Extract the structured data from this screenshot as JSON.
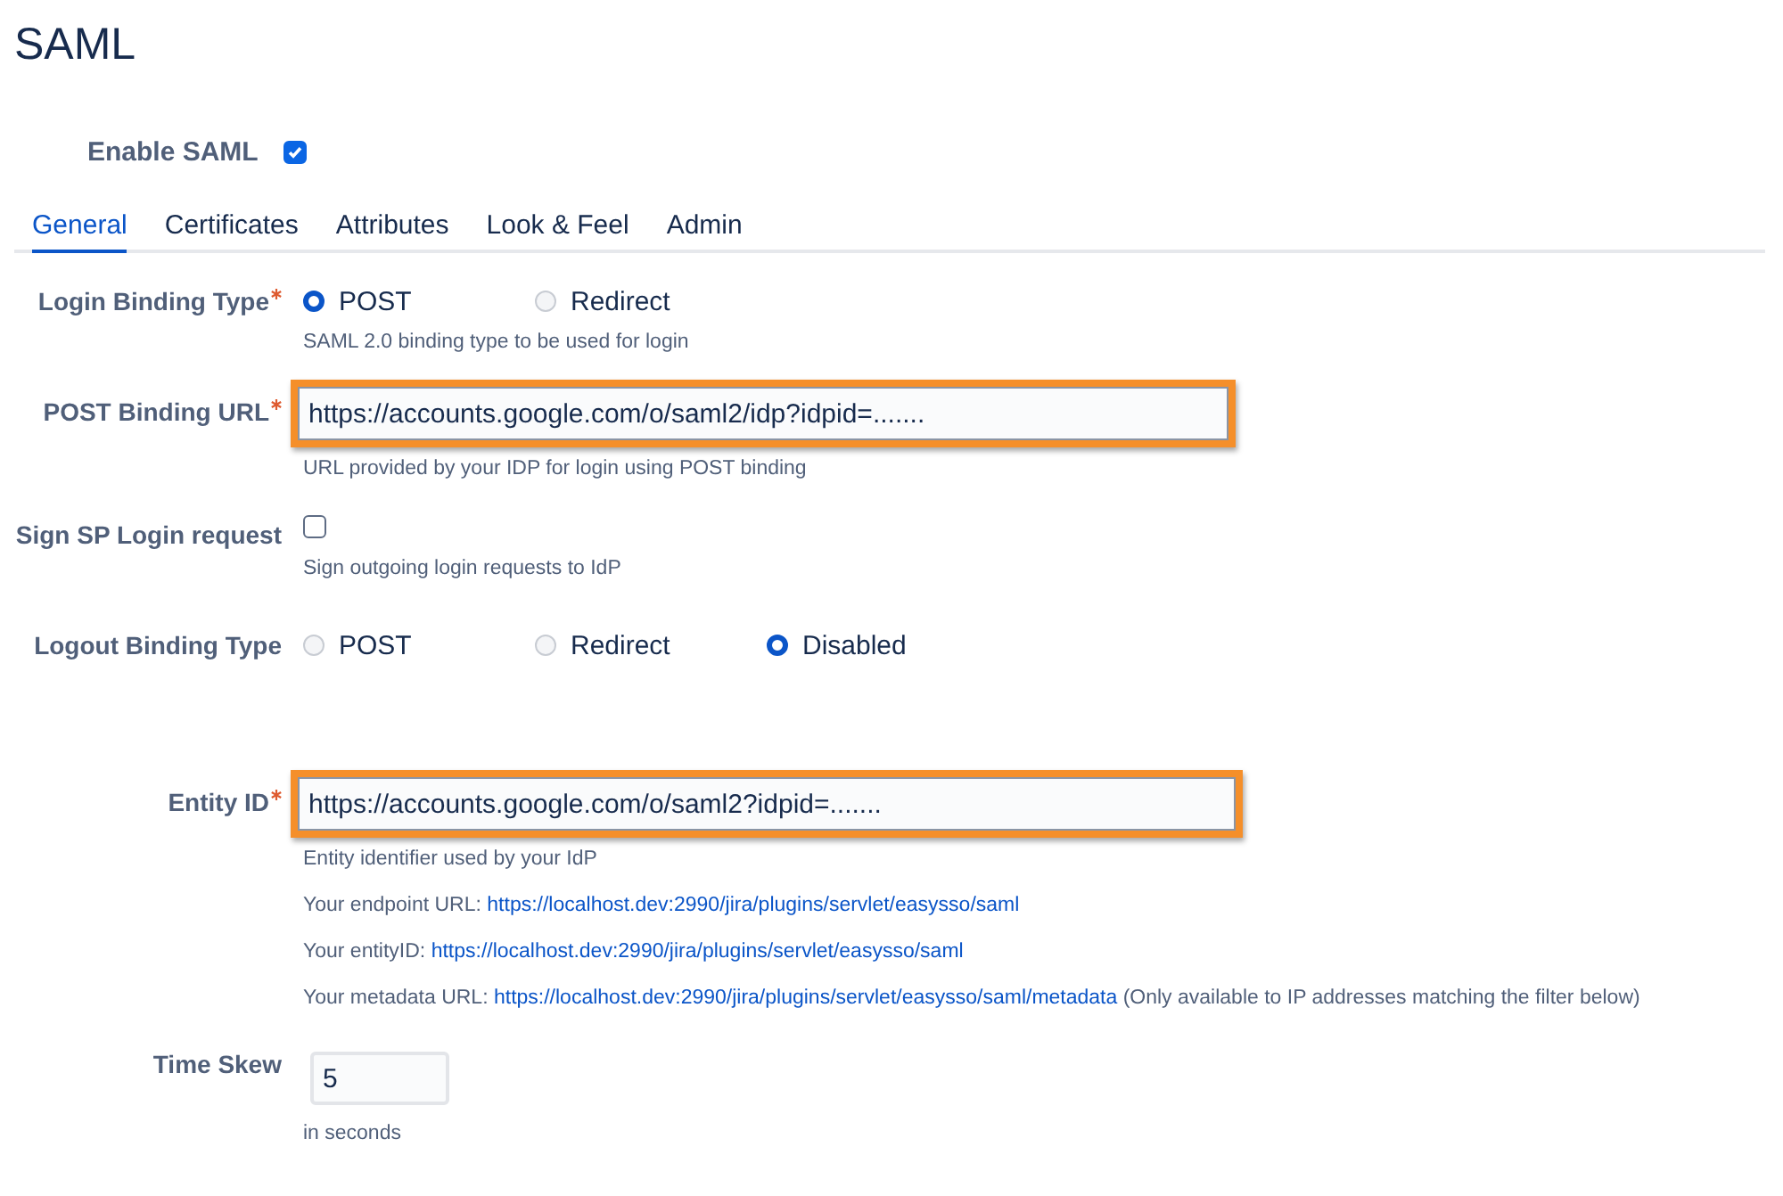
{
  "title": "SAML",
  "enable": {
    "label": "Enable SAML",
    "checked": true
  },
  "tabs": [
    {
      "label": "General",
      "selected": true
    },
    {
      "label": "Certificates",
      "selected": false
    },
    {
      "label": "Attributes",
      "selected": false
    },
    {
      "label": "Look & Feel",
      "selected": false
    },
    {
      "label": "Admin",
      "selected": false
    }
  ],
  "fields": [
    {
      "kind": "radio",
      "label": "Login Binding Type",
      "required": true,
      "options": [
        {
          "label": "POST",
          "selected": true
        },
        {
          "label": "Redirect",
          "selected": false
        }
      ],
      "help": "SAML 2.0 binding type to be used for login"
    },
    {
      "kind": "text",
      "label": "POST Binding URL",
      "required": true,
      "value": "https://accounts.google.com/o/saml2/idp?idpid=.......",
      "highlighted": true,
      "help": "URL provided by your IDP for login using POST binding"
    },
    {
      "kind": "checkbox",
      "label": "Sign SP Login request",
      "required": false,
      "checked": false,
      "help": "Sign outgoing login requests to IdP"
    },
    {
      "kind": "radio",
      "label": "Logout Binding Type",
      "required": false,
      "options": [
        {
          "label": "POST",
          "selected": false
        },
        {
          "label": "Redirect",
          "selected": false
        },
        {
          "label": "Disabled",
          "selected": true
        }
      ]
    },
    {
      "kind": "text",
      "label": "Entity ID",
      "required": true,
      "value": "https://accounts.google.com/o/saml2?idpid=.......",
      "highlighted": true,
      "help": "Entity identifier used by your IdP",
      "info": [
        {
          "text": "Your endpoint URL:",
          "link": "https://localhost.dev:2990/jira/plugins/servlet/easysso/saml"
        },
        {
          "text": "Your entityID:",
          "link": "https://localhost.dev:2990/jira/plugins/servlet/easysso/saml"
        },
        {
          "text": "Your metadata URL:",
          "link": "https://localhost.dev:2990/jira/plugins/servlet/easysso/saml/metadata",
          "note": "(Only available to IP addresses matching the filter below)"
        }
      ]
    },
    {
      "kind": "short",
      "label": "Time Skew",
      "required": false,
      "value": "5",
      "highlighted": false,
      "help": "in seconds"
    }
  ]
}
